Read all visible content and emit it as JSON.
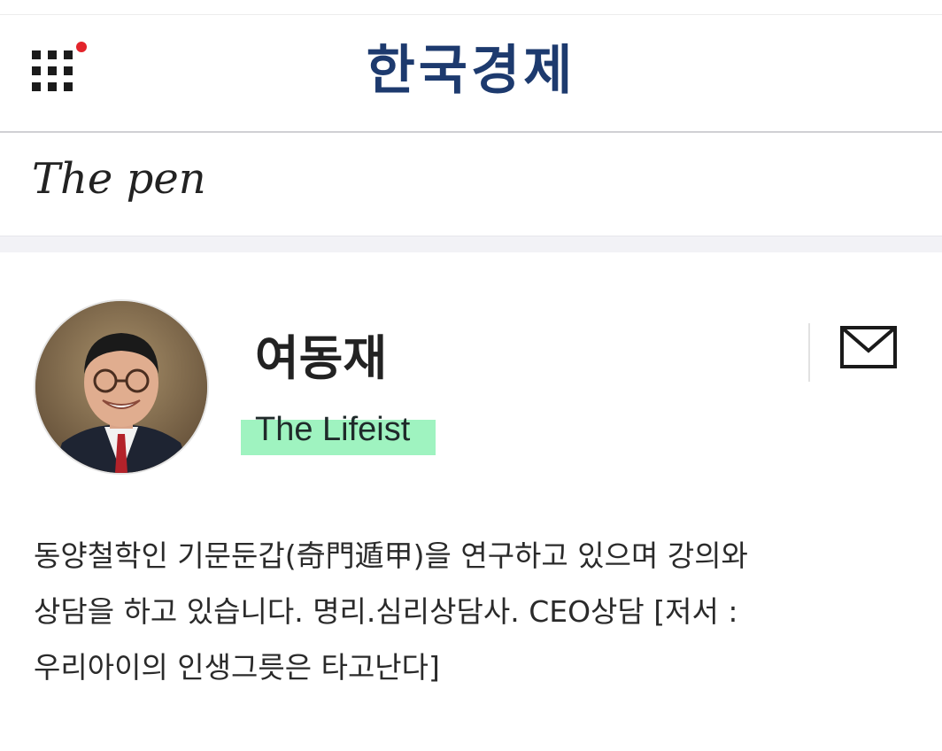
{
  "header": {
    "logo_text": "한국경제",
    "menu_icon": "grid-menu-icon",
    "notification_dot_color": "#e3242b"
  },
  "section": {
    "title": "The pen"
  },
  "author": {
    "name": "여동재",
    "tagline": "The Lifeist",
    "avatar_icon": "author-portrait",
    "contact_icon": "mail-icon",
    "highlight_color": "#9ff3c0",
    "bio_lines": [
      "동양철학인 기문둔갑(奇門遁甲)을 연구하고 있으며 강의와",
      "상담을 하고 있습니다. 명리.심리상담사. CEO상담 [저서 :",
      "우리아이의 인생그릇은 타고난다]"
    ]
  }
}
